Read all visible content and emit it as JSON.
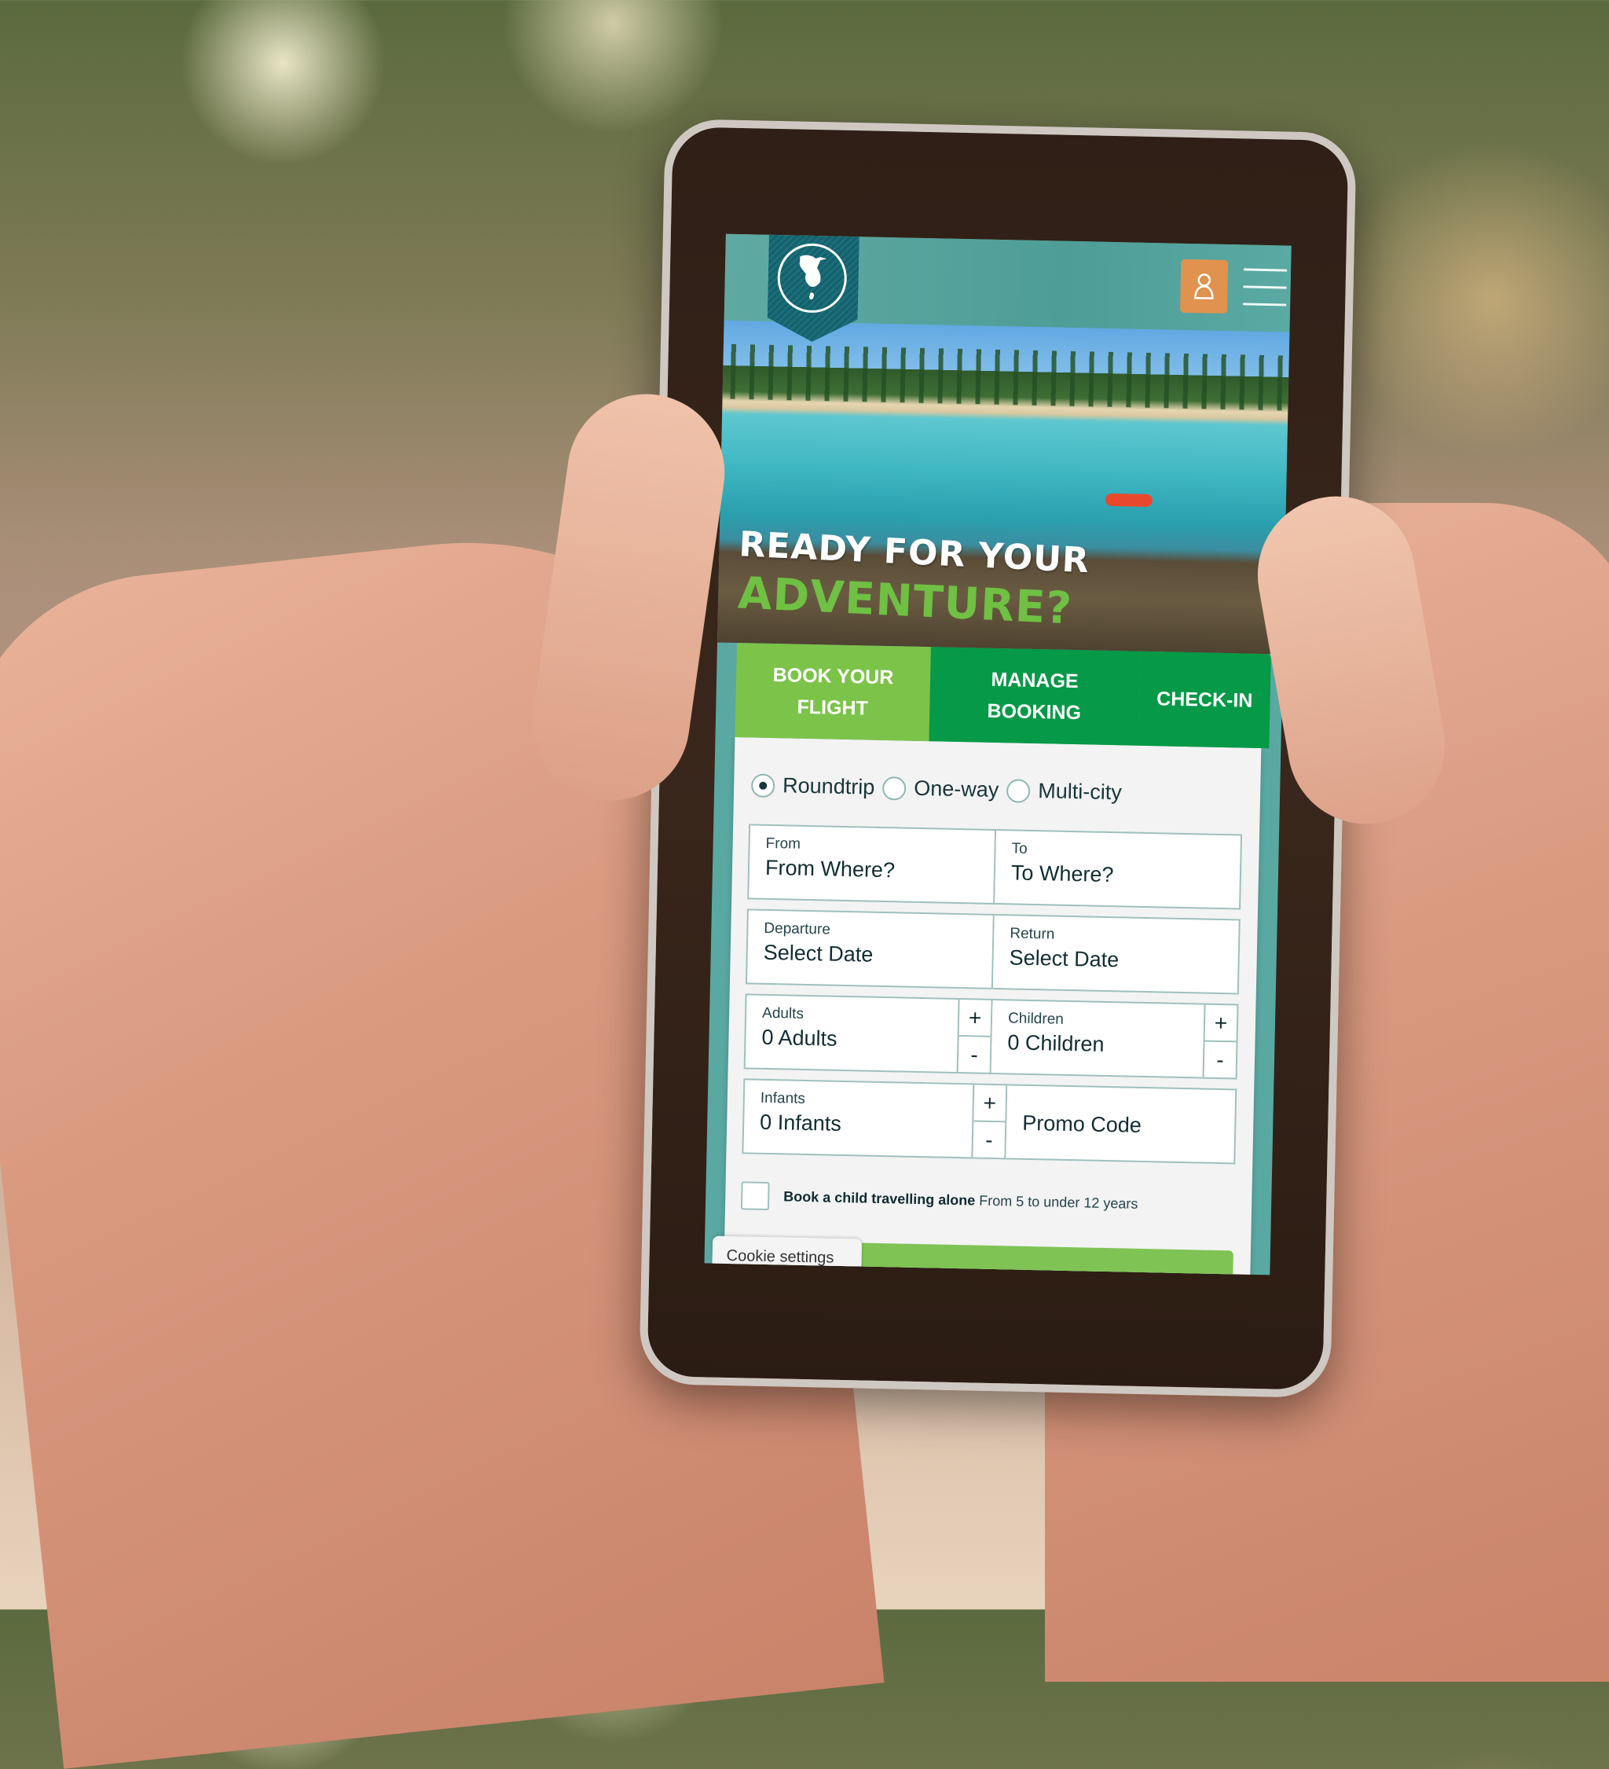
{
  "colors": {
    "header_teal": "#5aa8a2",
    "logo_banner": "#1a6f7a",
    "user_button": "#e0924e",
    "tab_active": "#7cc34a",
    "tab_inactive": "#069947",
    "headline_green": "#6fc043",
    "field_border": "#9ec0bd"
  },
  "header": {
    "logo_icon": "island-map-icon",
    "user_icon": "user-icon",
    "menu_icon": "hamburger-menu-icon"
  },
  "hero": {
    "headline_line1": "READY FOR YOUR",
    "headline_line2": "ADVENTURE?"
  },
  "tabs": [
    {
      "label": "BOOK YOUR FLIGHT",
      "active": true
    },
    {
      "label": "MANAGE BOOKING",
      "active": false
    },
    {
      "label": "CHECK-IN",
      "active": false
    }
  ],
  "form": {
    "trip_types": [
      {
        "label": "Roundtrip",
        "selected": true
      },
      {
        "label": "One-way",
        "selected": false
      },
      {
        "label": "Multi-city",
        "selected": false
      }
    ],
    "from": {
      "label": "From",
      "value": "From Where?"
    },
    "to": {
      "label": "To",
      "value": "To Where?"
    },
    "departure": {
      "label": "Departure",
      "value": "Select Date"
    },
    "return": {
      "label": "Return",
      "value": "Select Date"
    },
    "adults": {
      "label": "Adults",
      "value": "0 Adults"
    },
    "children": {
      "label": "Children",
      "value": "0 Children"
    },
    "infants": {
      "label": "Infants",
      "value": "0 Infants"
    },
    "promo_code": {
      "placeholder": "Promo Code"
    },
    "stepper_plus": "+",
    "stepper_minus": "-",
    "child_alone": {
      "bold": "Book a child travelling alone",
      "detail": "From 5 to under 12 years",
      "checked": false
    }
  },
  "cookie_settings_label": "Cookie settings"
}
